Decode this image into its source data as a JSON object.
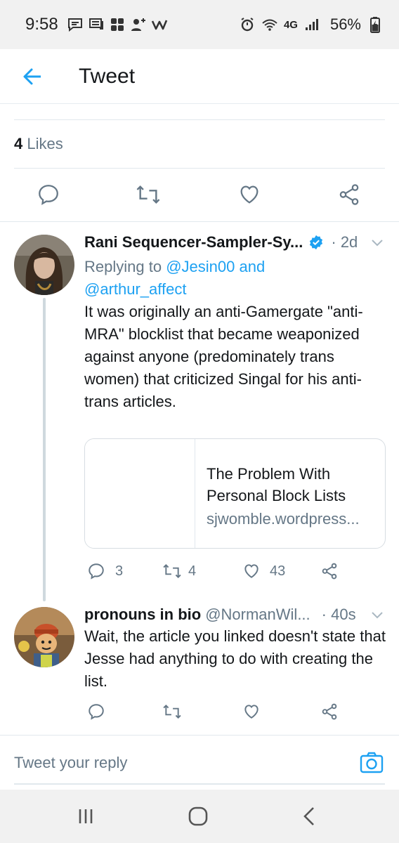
{
  "status_bar": {
    "time": "9:58",
    "network": "4G",
    "battery": "56%"
  },
  "header": {
    "title": "Tweet",
    "back_icon": "arrow-left-icon"
  },
  "main_tweet": {
    "likes_count": "4",
    "likes_label": "Likes"
  },
  "replies": [
    {
      "name": "Rani Sequencer-Sampler-Sy...",
      "verified": true,
      "time": "· 2d",
      "replying_prefix": "Replying to",
      "replying_to_1": "@Jesin00",
      "replying_and": "and",
      "replying_to_2": "@arthur_affect",
      "text": "It was originally an anti-Gamergate \"anti-MRA\" blocklist that became weaponized against anyone (predominately trans women) that criticized Singal for his anti-trans articles.",
      "card": {
        "title": "The Problem With Personal Block Lists",
        "domain": "sjwomble.wordpress..."
      },
      "reply_count": "3",
      "retweet_count": "4",
      "like_count": "43"
    },
    {
      "name": "pronouns in bio",
      "handle": "@NormanWil...",
      "time": "· 40s",
      "text": "Wait, the article you linked doesn't state that Jesse had anything to do with creating the list."
    }
  ],
  "reply_box": {
    "placeholder": "Tweet your reply"
  },
  "colors": {
    "accent": "#1da1f2",
    "muted": "#657786",
    "text": "#14171a"
  }
}
